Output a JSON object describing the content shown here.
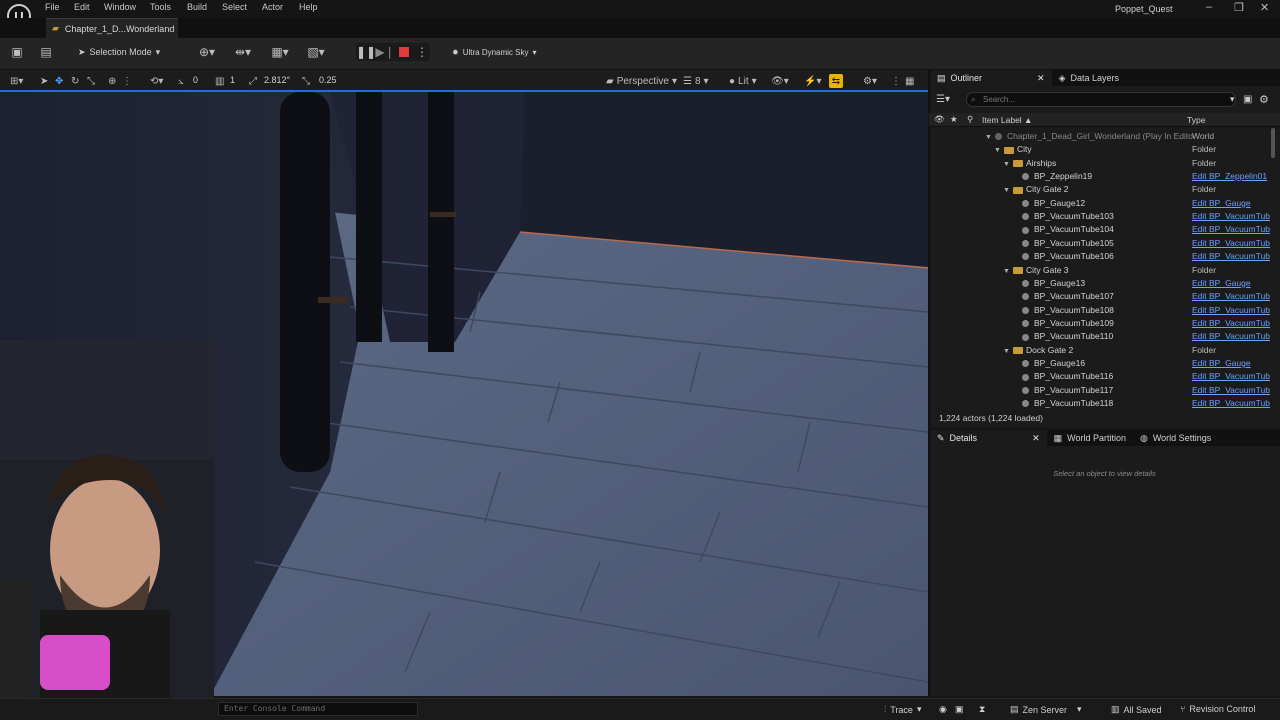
{
  "menu": [
    "File",
    "Edit",
    "Window",
    "Tools",
    "Build",
    "Select",
    "Actor",
    "Help"
  ],
  "project_name": "Poppet_Quest",
  "level_tab": "Chapter_1_D...Wonderland",
  "toolbar": {
    "selection_mode": "Selection Mode",
    "sky": "Ultra Dynamic Sky"
  },
  "viewport_toolbar": {
    "rotation_snap": "0",
    "scale_snap": "1",
    "camera_speed": "2.812°",
    "grid": "0.25",
    "view_mode": "Perspective",
    "camera_count": "8",
    "lit": "Lit"
  },
  "outliner": {
    "tab_label": "Outliner",
    "data_layers_label": "Data Layers",
    "search_placeholder": "Search...",
    "col_label": "Item Label ▲",
    "col_type": "Type",
    "rows": [
      {
        "indent": 0,
        "kind": "world",
        "label": "Chapter_1_Dead_Girl_Wonderland (Play In Edito",
        "type": "World",
        "link": false
      },
      {
        "indent": 1,
        "kind": "folder",
        "label": "City",
        "type": "Folder",
        "link": false
      },
      {
        "indent": 2,
        "kind": "folder",
        "label": "Airships",
        "type": "Folder",
        "link": false
      },
      {
        "indent": 3,
        "kind": "actor",
        "label": "BP_Zeppelin19",
        "type": "Edit BP_Zeppelin01",
        "link": true
      },
      {
        "indent": 2,
        "kind": "folder",
        "label": "City Gate 2",
        "type": "Folder",
        "link": false
      },
      {
        "indent": 3,
        "kind": "actor",
        "label": "BP_Gauge12",
        "type": "Edit BP_Gauge",
        "link": true
      },
      {
        "indent": 3,
        "kind": "actor",
        "label": "BP_VacuumTube103",
        "type": "Edit BP_VacuumTub",
        "link": true
      },
      {
        "indent": 3,
        "kind": "actor",
        "label": "BP_VacuumTube104",
        "type": "Edit BP_VacuumTub",
        "link": true
      },
      {
        "indent": 3,
        "kind": "actor",
        "label": "BP_VacuumTube105",
        "type": "Edit BP_VacuumTub",
        "link": true
      },
      {
        "indent": 3,
        "kind": "actor",
        "label": "BP_VacuumTube106",
        "type": "Edit BP_VacuumTub",
        "link": true
      },
      {
        "indent": 2,
        "kind": "folder",
        "label": "City Gate 3",
        "type": "Folder",
        "link": false
      },
      {
        "indent": 3,
        "kind": "actor",
        "label": "BP_Gauge13",
        "type": "Edit BP_Gauge",
        "link": true
      },
      {
        "indent": 3,
        "kind": "actor",
        "label": "BP_VacuumTube107",
        "type": "Edit BP_VacuumTub",
        "link": true
      },
      {
        "indent": 3,
        "kind": "actor",
        "label": "BP_VacuumTube108",
        "type": "Edit BP_VacuumTub",
        "link": true
      },
      {
        "indent": 3,
        "kind": "actor",
        "label": "BP_VacuumTube109",
        "type": "Edit BP_VacuumTub",
        "link": true
      },
      {
        "indent": 3,
        "kind": "actor",
        "label": "BP_VacuumTube110",
        "type": "Edit BP_VacuumTub",
        "link": true
      },
      {
        "indent": 2,
        "kind": "folder",
        "label": "Dock Gate 2",
        "type": "Folder",
        "link": false
      },
      {
        "indent": 3,
        "kind": "actor",
        "label": "BP_Gauge16",
        "type": "Edit BP_Gauge",
        "link": true
      },
      {
        "indent": 3,
        "kind": "actor",
        "label": "BP_VacuumTube116",
        "type": "Edit BP_VacuumTub",
        "link": true
      },
      {
        "indent": 3,
        "kind": "actor",
        "label": "BP_VacuumTube117",
        "type": "Edit BP_VacuumTub",
        "link": true
      },
      {
        "indent": 3,
        "kind": "actor",
        "label": "BP_VacuumTube118",
        "type": "Edit BP_VacuumTub",
        "link": true
      }
    ],
    "actor_count": "1,224 actors (1,224 loaded)"
  },
  "details": {
    "tab_label": "Details",
    "world_partition_label": "World Partition",
    "world_settings_label": "World Settings",
    "empty_text": "Select an object to view details"
  },
  "statusbar": {
    "console_placeholder": "Enter Console Command",
    "trace": "Trace",
    "zen_server": "Zen Server",
    "all_saved": "All Saved",
    "revision_control": "Revision Control"
  },
  "colors": {
    "accent_blue": "#1e6fd0",
    "link_blue": "#6fa0ff",
    "folder": "#c89a3a",
    "stop_red": "#e23a3a",
    "snap_yellow": "#e8b400"
  }
}
